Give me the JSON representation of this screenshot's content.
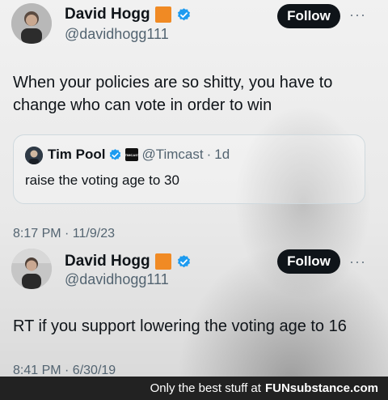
{
  "tweets": [
    {
      "display_name": "David Hogg",
      "handle": "@davidhogg111",
      "follow_label": "Follow",
      "more_label": "···",
      "text": "When your policies are so shitty, you have to change who can vote in order to win",
      "quote": {
        "display_name": "Tim Pool",
        "affiliate": "TIMCAST",
        "handle": "@Timcast",
        "separator": "·",
        "time": "1d",
        "text": "raise the voting age to 30"
      },
      "timestamp": "8:17 PM · 11/9/23"
    },
    {
      "display_name": "David Hogg",
      "handle": "@davidhogg111",
      "follow_label": "Follow",
      "more_label": "···",
      "text": "RT if you support lowering the voting age to 16",
      "timestamp": "8:41 PM · 6/30/19"
    }
  ],
  "footer": {
    "text": "Only the best stuff at",
    "brand": "FUNsubstance.com"
  },
  "colors": {
    "badge": "#f08a24",
    "verified": "#1d9bf0",
    "follow_bg": "#0f1419"
  }
}
